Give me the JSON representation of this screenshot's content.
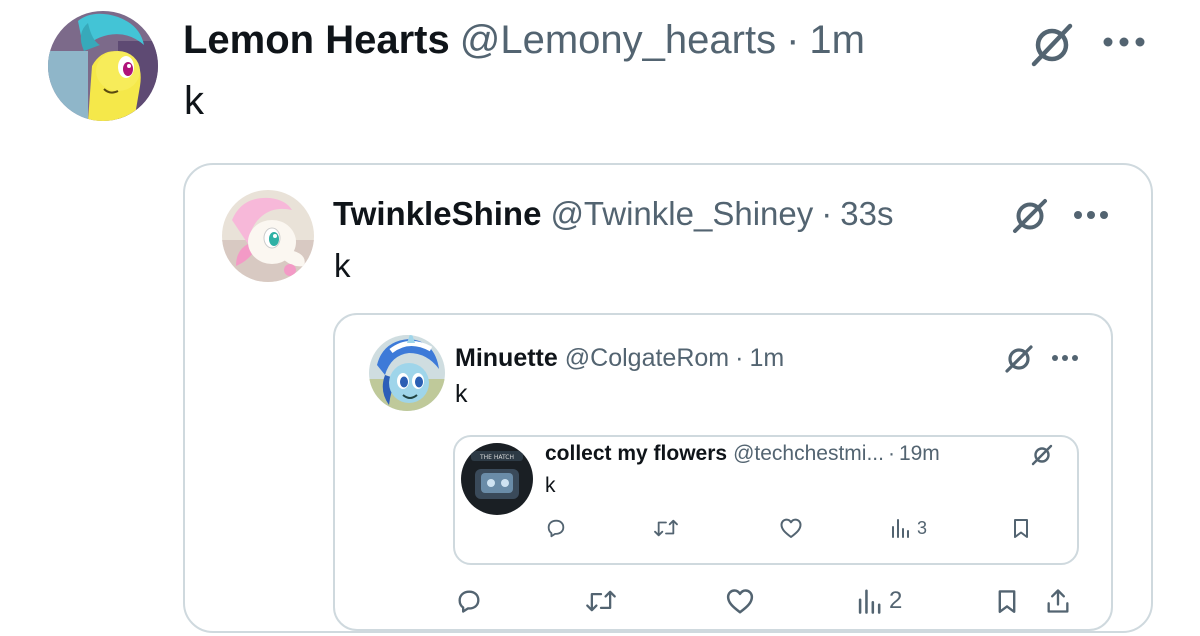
{
  "tweet": {
    "display_name": "Lemon Hearts",
    "handle": "@Lemony_hearts",
    "separator": "·",
    "time": "1m",
    "text": "k",
    "icons": {
      "grok": "slashed-circle-icon",
      "more": "more-icon"
    }
  },
  "quote1": {
    "display_name": "TwinkleShine",
    "handle": "@Twinkle_Shiney",
    "separator": "·",
    "time": "33s",
    "text": "k"
  },
  "quote2": {
    "display_name": "Minuette",
    "handle": "@ColgateRom",
    "separator": "·",
    "time": "1m",
    "text": "k",
    "actions": {
      "views": "2"
    }
  },
  "quote3": {
    "display_name": "collect my flowers",
    "handle": "@techchestmi...",
    "separator": "·",
    "time": "19m",
    "text": "k",
    "avatar_text": "THE HATCH",
    "actions": {
      "views": "3"
    }
  },
  "colors": {
    "text": "#0f1419",
    "secondary": "#536471",
    "border": "#cfd9de",
    "lemon_yellow": "#f5e84a",
    "minuette_blue": "#3d7ad8"
  }
}
